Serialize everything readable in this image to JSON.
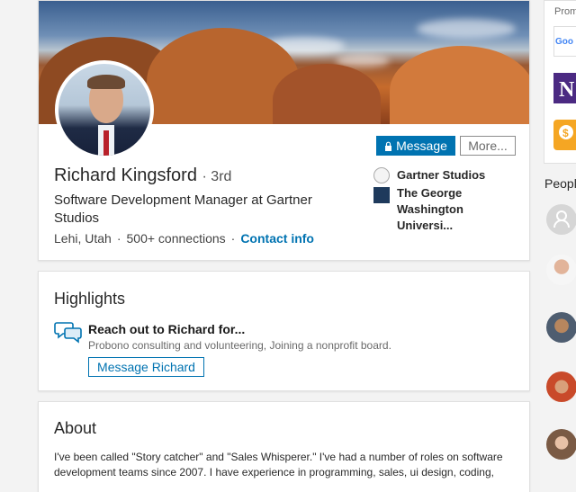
{
  "profile": {
    "name": "Richard Kingsford",
    "degree": "· 3rd",
    "headline": "Software Development Manager at Gartner Studios",
    "location": "Lehi, Utah",
    "connections": "500+ connections",
    "contact_info": "Contact info",
    "separator": "·",
    "message_button": "Message",
    "more_button": "More...",
    "orgs": [
      {
        "name": "Gartner Studios",
        "logo_icon": "gartner-logo-icon"
      },
      {
        "name": "The George Washington Universi...",
        "logo_icon": "gwu-logo-icon"
      }
    ]
  },
  "highlights": {
    "title": "Highlights",
    "heading": "Reach out to Richard for...",
    "description": "Probono consulting and volunteering, Joining a nonprofit board.",
    "button": "Message Richard"
  },
  "about": {
    "title": "About",
    "text": "I've been called \"Story catcher\" and \"Sales Whisperer.\" I've had a number of roles on software development teams since 2007. I have experience in programming, sales, ui design, coding,"
  },
  "right_rail": {
    "promoted_label": "Prom",
    "people_label": "Peopl"
  },
  "colors": {
    "primary": "#0073b1",
    "page_bg": "#f3f3f3"
  }
}
